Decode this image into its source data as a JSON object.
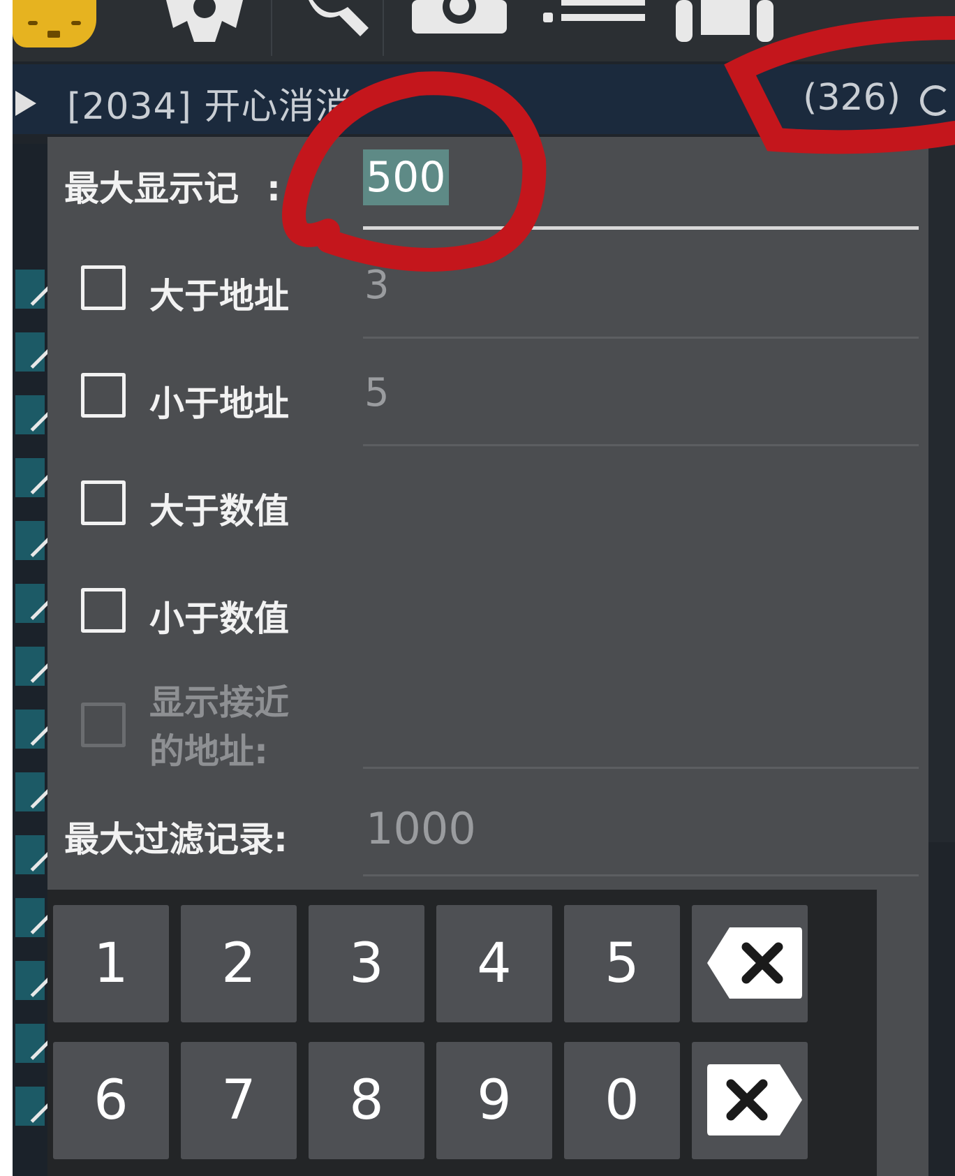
{
  "toolbar": {
    "icons": [
      "mascot-icon",
      "gear-icon",
      "search-icon",
      "camera-icon",
      "list-icon",
      "android-icon"
    ]
  },
  "titlebar": {
    "title": "[2034] 开心消消",
    "count": "(326)"
  },
  "dialog": {
    "max_display_label": "最大显示记",
    "max_display_label_colon": ":",
    "max_display_value": "500",
    "filters": [
      {
        "label": "大于地址",
        "value": "3"
      },
      {
        "label": "小于地址",
        "value": "5"
      },
      {
        "label": "大于数值",
        "value": ""
      },
      {
        "label": "小于数值",
        "value": ""
      }
    ],
    "show_near_line1": "显示接近",
    "show_near_line2": "的地址:",
    "max_filter_label": "最大过滤记录:",
    "max_filter_value": "1000"
  },
  "keypad": {
    "row1": [
      "1",
      "2",
      "3",
      "4",
      "5"
    ],
    "row2": [
      "6",
      "7",
      "8",
      "9",
      "0"
    ],
    "backspace_icon": "backspace-icon",
    "clear_icon": "delete-icon"
  },
  "colors": {
    "dialog_bg": "#4b4d50",
    "selection": "#5e8a86",
    "annotation_red": "#c4161c"
  }
}
